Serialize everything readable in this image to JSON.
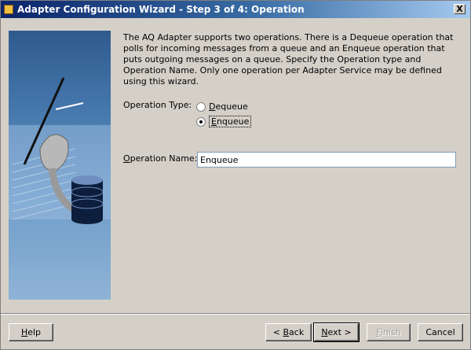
{
  "window": {
    "title": "Adapter Configuration Wizard - Step 3 of 4: Operation",
    "close_symbol": "X"
  },
  "description": "The AQ Adapter supports two operations.  There is a Dequeue operation that polls for incoming messages from a queue and an Enqueue operation that puts outgoing messages on a queue.  Specify the Operation type and Operation Name. Only one operation per Adapter Service may be defined using this wizard.",
  "operation_type": {
    "label": "Operation Type:",
    "options": [
      {
        "label": "Dequeue",
        "selected": false
      },
      {
        "label": "Enqueue",
        "selected": true
      }
    ]
  },
  "operation_name": {
    "label": "Operation Name:",
    "value": "Enqueue"
  },
  "buttons": {
    "help": "Help",
    "back": "< Back",
    "next": "Next >",
    "finish": "Finish",
    "cancel": "Cancel"
  }
}
